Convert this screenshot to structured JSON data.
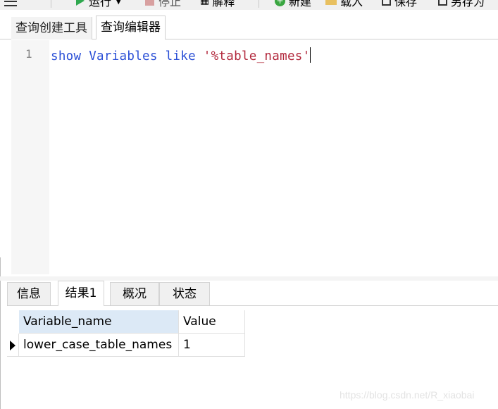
{
  "toolbar": {
    "run_label": "运行",
    "stop_label": "停止",
    "explain_label": "解释",
    "new_label": "新建",
    "load_label": "载入",
    "save_label": "保存",
    "saveas_label": "另存为"
  },
  "editor_tabs": {
    "query_builder": "查询创建工具",
    "query_editor": "查询编辑器"
  },
  "editor": {
    "line_number": "1",
    "code": {
      "kw1": "show",
      "ident": "Variables",
      "kw2": "like",
      "string": "'%table_names'"
    }
  },
  "result_tabs": {
    "info": "信息",
    "result1": "结果1",
    "profile": "概况",
    "status": "状态"
  },
  "grid": {
    "columns": [
      "Variable_name",
      "Value"
    ],
    "rows": [
      [
        "lower_case_table_names",
        "1"
      ]
    ]
  },
  "watermark": "https://blog.csdn.net/R_xiaobai",
  "colors": {
    "keyword": "#2a4fd6",
    "string": "#b2283c",
    "header_bg": "#dce9f6",
    "run_icon": "#2fa84f"
  }
}
